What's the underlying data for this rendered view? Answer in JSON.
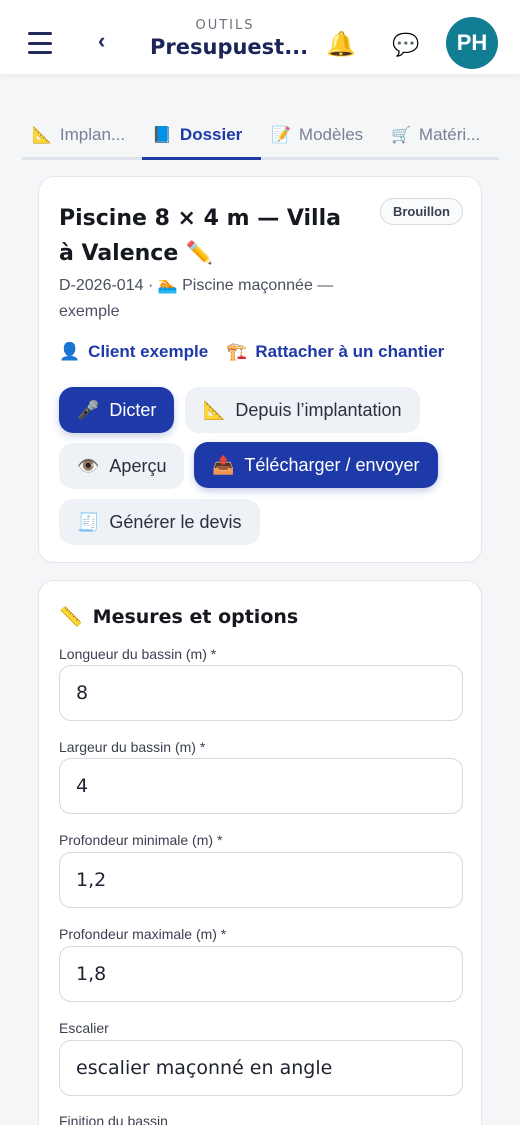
{
  "header": {
    "kicker": "OUTILS",
    "title": "Presupuest...",
    "back": "‹",
    "bell": "🔔",
    "chat": "💬",
    "avatar": "PH"
  },
  "tabs": [
    {
      "icon": "📐",
      "label": "Implan..."
    },
    {
      "icon": "📘",
      "label": "Dossier"
    },
    {
      "icon": "📝",
      "label": "Modèles"
    },
    {
      "icon": "🛒",
      "label": "Matéri..."
    }
  ],
  "dossier": {
    "title": "Piscine 8 × 4 m — Villa à Valence ✏️",
    "status": "Brouillon",
    "reference": "D-2026-014",
    "type_icon": "🏊",
    "type": "Piscine maçonnée — exemple",
    "client": {
      "icon": "👤",
      "label": "Client exemple"
    },
    "chantier": {
      "icon": "🏗️",
      "label": "Rattacher à un chantier"
    },
    "buttons": {
      "dicter": {
        "icon": "🎤",
        "label": "Dicter"
      },
      "implantation": {
        "icon": "📐",
        "label": "Depuis l’implantation"
      },
      "apercu": {
        "icon": "👁️",
        "label": "Aperçu"
      },
      "telecharger": {
        "icon": "📤",
        "label": "Télécharger / envoyer"
      },
      "devis": {
        "icon": "🧾",
        "label": "Générer le devis"
      }
    }
  },
  "mesures": {
    "icon": "📏",
    "title": "Mesures et options",
    "fields": [
      {
        "label": "Longueur du bassin (m) *",
        "value": "8"
      },
      {
        "label": "Largeur du bassin (m) *",
        "value": "4"
      },
      {
        "label": "Profondeur minimale (m) *",
        "value": "1,2"
      },
      {
        "label": "Profondeur maximale (m) *",
        "value": "1,8"
      },
      {
        "label": "Escalier",
        "value": "escalier maçonné en angle"
      },
      {
        "label": "Finition du bassin",
        "value": ""
      }
    ]
  }
}
